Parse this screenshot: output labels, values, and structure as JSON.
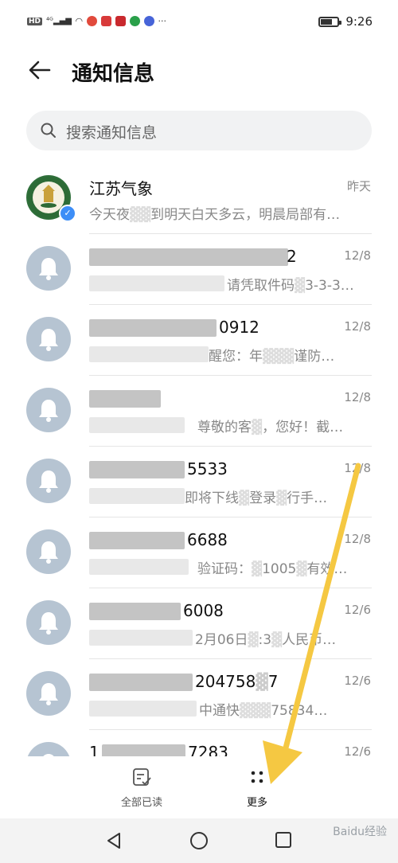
{
  "status_bar": {
    "left_icons": [
      "HD",
      "4G",
      "signal-icon",
      "wifi-icon",
      "weibo-icon",
      "app-icon-red",
      "app-icon-red2",
      "app-icon-green",
      "app-icon-blue",
      "..."
    ],
    "time": "9:26"
  },
  "header": {
    "title": "通知信息"
  },
  "search": {
    "placeholder": "搜索通知信息"
  },
  "messages": [
    {
      "name": "江苏气象",
      "date": "昨天",
      "preview": "今天夜[blur]到明天白天多云，明晨局部有…"
    },
    {
      "name": "[blur]2",
      "date": "12/8",
      "preview": "[blur]请凭取件码[blur]3-3-3…"
    },
    {
      "name": "[blur]0912",
      "date": "12/8",
      "preview": "[blur]醒您：年[blur]谨防…"
    },
    {
      "name": "[blur]",
      "date": "12/8",
      "preview": "[blur]尊敬的客[blur]，您好！截…"
    },
    {
      "name": "[blur]5533",
      "date": "12/8",
      "preview": "[blur]即将下线[blur]登录[blur]行手…"
    },
    {
      "name": "[blur]6688",
      "date": "12/8",
      "preview": "[blur]验证码：[blur]1005[blur]有效…"
    },
    {
      "name": "[blur]6008",
      "date": "12/6",
      "preview": "[blur]2月06日[blur]:3[blur]人民币…"
    },
    {
      "name": "[blur]204758[blur]7",
      "date": "12/6",
      "preview": "[blur]中通快[blur]75834…"
    },
    {
      "name": "1[blur]7283",
      "date": "12/6",
      "preview": ""
    }
  ],
  "bottom_bar": {
    "mark_all_read": "全部已读",
    "more": "更多"
  },
  "watermark": "Baidu经验",
  "colors": {
    "arrow": "#f5c842",
    "avatar": "#b6c4d2",
    "badge": "#3d8ef7"
  }
}
